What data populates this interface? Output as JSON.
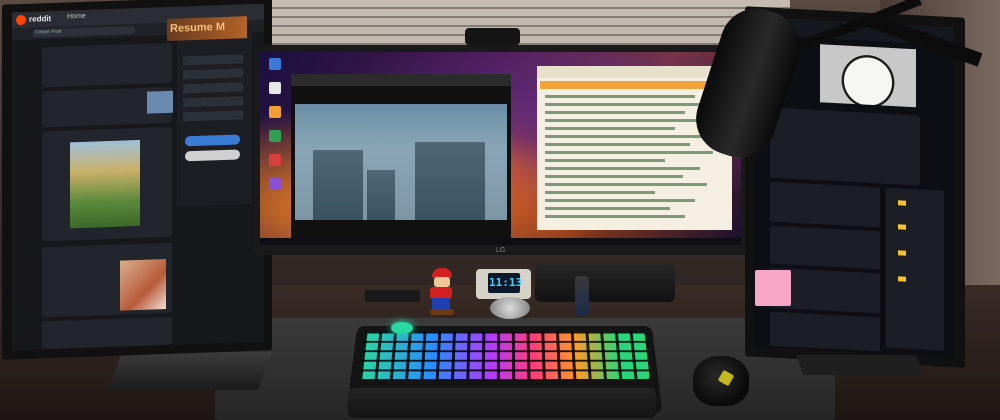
{
  "left_screen": {
    "brand": "reddit",
    "tab": "Home",
    "search_placeholder": "Create Post",
    "banner": "Resume M"
  },
  "center_screen": {
    "brand": "LG"
  },
  "desk_clock": {
    "time": "11:13"
  },
  "colors": {
    "keyboard_rgb": "#b03cff",
    "reddit_orange": "#ff4500",
    "devto_pink": "#f7a6c6",
    "clock_digits": "#4ad0ff"
  }
}
